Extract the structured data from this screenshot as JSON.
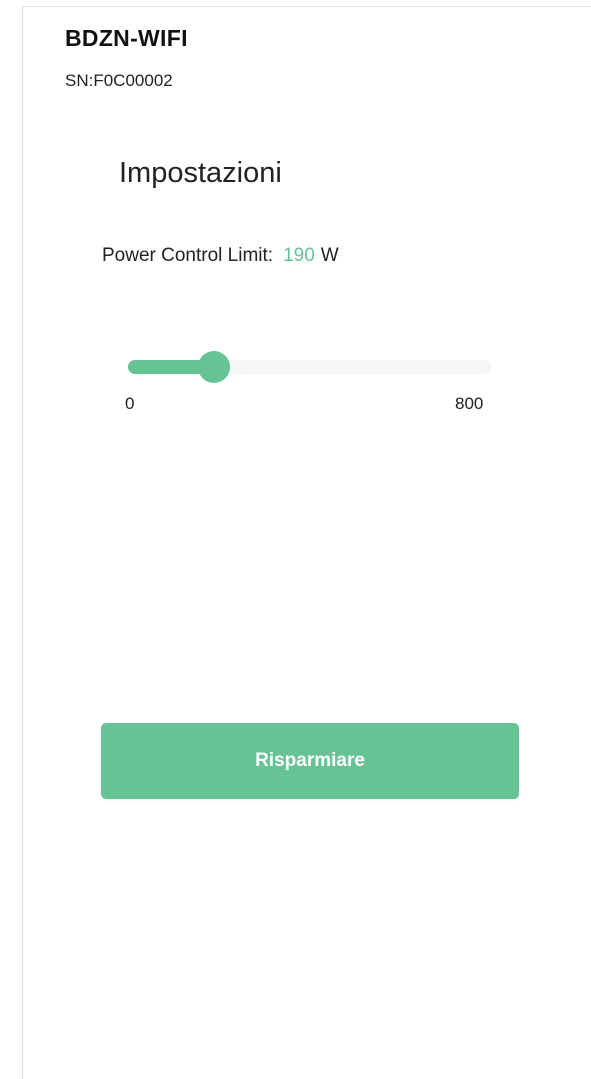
{
  "header": {
    "device_name": "BDZN-WIFI",
    "serial": "SN:F0C00002"
  },
  "settings": {
    "title": "Impostazioni",
    "power_limit": {
      "label": "Power Control Limit:",
      "value": "190",
      "unit": "W"
    },
    "slider": {
      "min": 0,
      "max": 800,
      "value": 190,
      "min_label": "0",
      "max_label": "800"
    }
  },
  "actions": {
    "save_label": "Risparmiare"
  },
  "colors": {
    "accent": "#66c394",
    "track": "#f6f6f6",
    "background": "#ffffff"
  }
}
